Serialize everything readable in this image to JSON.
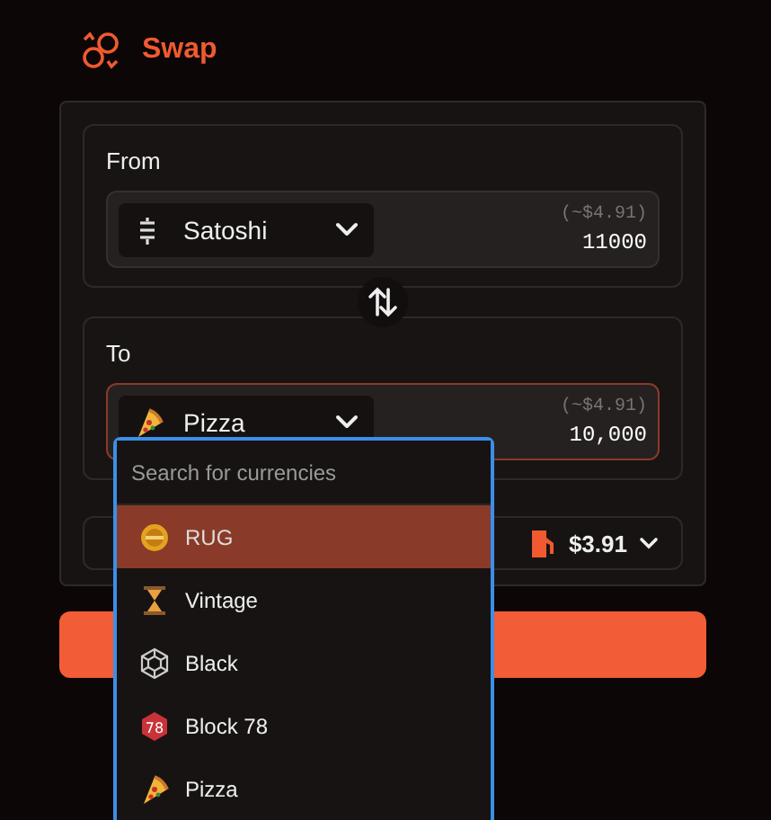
{
  "header": {
    "title": "Swap"
  },
  "from": {
    "label": "From",
    "currency": {
      "name": "Satoshi",
      "kind": "satoshi"
    },
    "usd": "(~$4.91)",
    "amount": "11000"
  },
  "to": {
    "label": "To",
    "currency": {
      "name": "Pizza",
      "kind": "pizza"
    },
    "usd": "(~$4.91)",
    "amount": "10,000",
    "error": true
  },
  "fee": {
    "amount": "$3.91"
  },
  "dropdown": {
    "placeholder": "Search for currencies",
    "items": [
      {
        "name": "RUG",
        "kind": "coin",
        "selected": true
      },
      {
        "name": "Vintage",
        "kind": "hourglass",
        "selected": false
      },
      {
        "name": "Black",
        "kind": "gem",
        "selected": false
      },
      {
        "name": "Block 78",
        "kind": "badge",
        "icon_text": "78",
        "selected": false
      },
      {
        "name": "Pizza",
        "kind": "pizza",
        "selected": false
      }
    ]
  }
}
